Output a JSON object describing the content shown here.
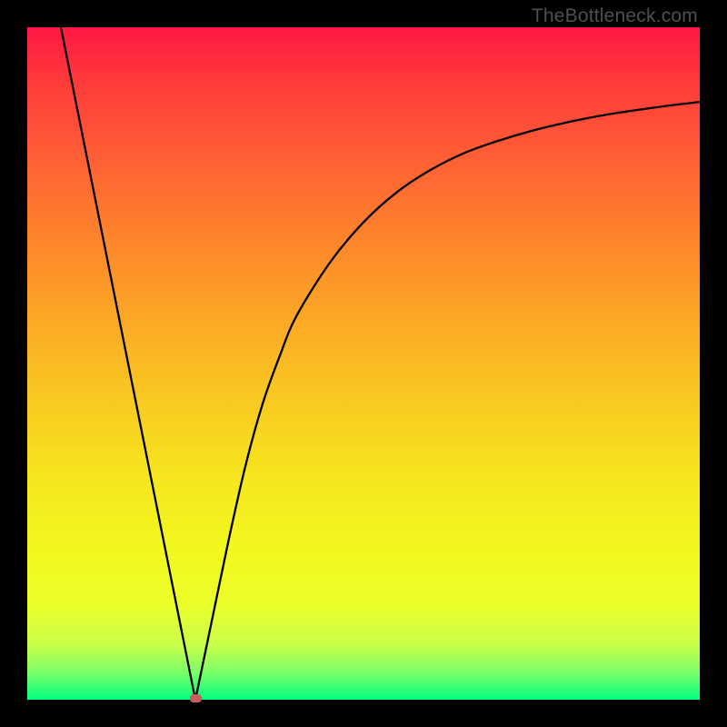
{
  "attribution": "TheBottleneck.com",
  "chart_data": {
    "type": "line",
    "title": "",
    "xlabel": "",
    "ylabel": "",
    "xlim": [
      0,
      100
    ],
    "ylim": [
      0,
      100
    ],
    "x_minimum": 25.0,
    "minimum_marker_color": "#cd5c5c",
    "series": [
      {
        "name": "curve",
        "x": [
          5,
          7.5,
          10,
          12.5,
          15,
          17.5,
          20,
          22.5,
          25,
          27.5,
          30,
          32.5,
          35,
          37.5,
          40,
          45,
          50,
          55,
          60,
          65,
          70,
          75,
          80,
          85,
          90,
          95,
          100
        ],
        "y": [
          100,
          87.5,
          75,
          62.5,
          50,
          37.5,
          25,
          12.5,
          0,
          12,
          24,
          35,
          44,
          51,
          57,
          65,
          71,
          75.5,
          78.8,
          81.3,
          83.1,
          84.6,
          85.8,
          86.8,
          87.6,
          88.3,
          88.9
        ]
      }
    ],
    "background_gradient": {
      "top": "#ff1844",
      "middle": "#fbb524",
      "bottom": "#00ff7f"
    },
    "plot_frame_color": "#000000"
  }
}
